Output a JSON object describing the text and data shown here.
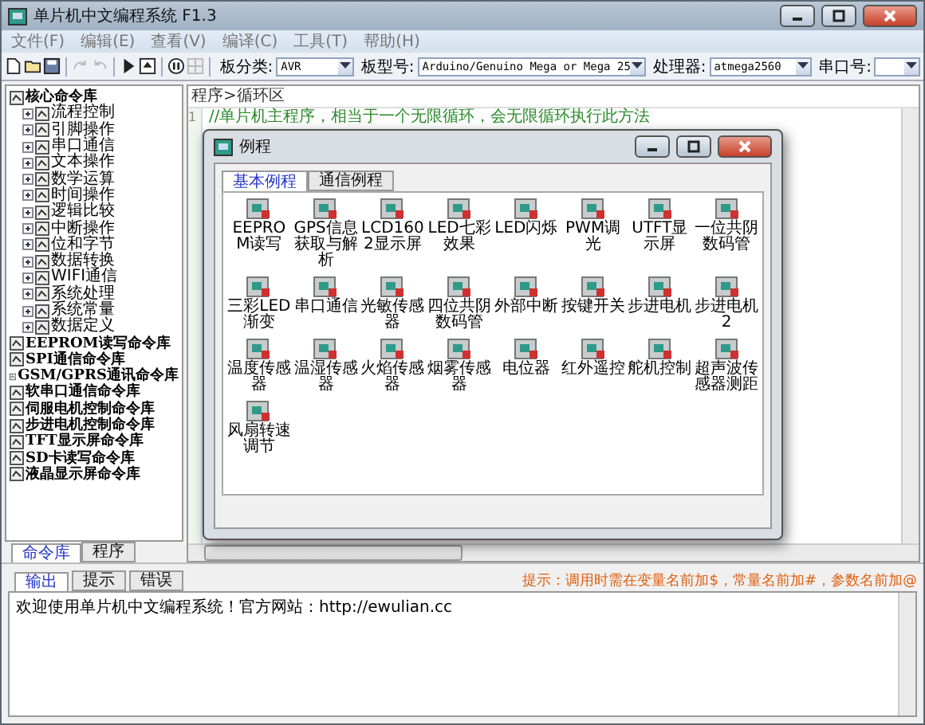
{
  "window": {
    "title": "单片机中文编程系统 F1.3"
  },
  "menu": [
    "文件(F)",
    "编辑(E)",
    "查看(V)",
    "编译(C)",
    "工具(T)",
    "帮助(H)"
  ],
  "toolbar": {
    "groups": [
      [
        {
          "kind": "new",
          "disabled": false
        },
        {
          "kind": "open",
          "disabled": false
        },
        {
          "kind": "save",
          "disabled": false
        }
      ],
      [
        {
          "kind": "redo",
          "disabled": true
        },
        {
          "kind": "undo",
          "disabled": true
        }
      ],
      [
        {
          "kind": "run",
          "disabled": false
        },
        {
          "kind": "upload",
          "disabled": false
        }
      ],
      [
        {
          "kind": "pause",
          "disabled": false
        },
        {
          "kind": "monitor",
          "disabled": true
        }
      ]
    ],
    "selectors": [
      {
        "label": "板分类:",
        "value": "AVR"
      },
      {
        "label": "板型号:",
        "value": "Arduino/Genuino Mega or Mega 25"
      },
      {
        "label": "处理器:",
        "value": "atmega2560"
      },
      {
        "label": "串口号:"
      }
    ]
  },
  "library": {
    "tree": [
      {
        "label": "核心命令库",
        "children": [
          {
            "label": "流程控制",
            "expanded": false
          },
          {
            "label": "引脚操作",
            "expanded": false
          },
          {
            "label": "串口通信",
            "expanded": false
          },
          {
            "label": "文本操作",
            "expanded": false
          },
          {
            "label": "数学运算",
            "expanded": false
          },
          {
            "label": "时间操作",
            "expanded": false
          },
          {
            "label": "逻辑比较",
            "expanded": false
          },
          {
            "label": "中断操作",
            "expanded": false
          },
          {
            "label": "位和字节",
            "expanded": false
          },
          {
            "label": "数据转换",
            "expanded": false
          },
          {
            "label": "WIFI通信",
            "expanded": false
          },
          {
            "label": "系统处理",
            "expanded": false
          },
          {
            "label": "系统常量",
            "expanded": false
          },
          {
            "label": "数据定义",
            "expanded": false
          }
        ]
      },
      {
        "label": "EEPROM读写命令库"
      },
      {
        "label": "SPI通信命令库"
      },
      {
        "label": "GSM/GPRS通讯命令库"
      },
      {
        "label": "软串口通信命令库"
      },
      {
        "label": "伺服电机控制命令库"
      },
      {
        "label": "步进电机控制命令库"
      },
      {
        "label": "TFT显示屏命令库"
      },
      {
        "label": "SD卡读写命令库"
      },
      {
        "label": "液晶显示屏命令库"
      }
    ],
    "tabs": [
      {
        "label": "命令库",
        "selected": true
      },
      {
        "label": "程序",
        "selected": false
      }
    ]
  },
  "editor": {
    "breadcrumb": "程序>循环区",
    "lines": [
      {
        "number": "1",
        "text": "//单片机主程序，相当于一个无限循环，会无限循环执行此方法"
      }
    ]
  },
  "dialog": {
    "title": "例程",
    "tabs": [
      {
        "label": "基本例程",
        "selected": true
      },
      {
        "label": "通信例程",
        "selected": false
      }
    ],
    "examples": [
      "EEPROM读写",
      "GPS信息获取与解析",
      "LCD1602显示屏",
      "LED七彩效果",
      "LED闪烁",
      "PWM调光",
      "UTFT显示屏",
      "一位共阴数码管",
      "三彩LED渐变",
      "串口通信",
      "光敏传感器",
      "四位共阴数码管",
      "外部中断",
      "按键开关",
      "步进电机",
      "步进电机2",
      "温度传感器",
      "温湿传感器",
      "火焰传感器",
      "烟雾传感器",
      "电位器",
      "红外遥控",
      "舵机控制",
      "超声波传感器测距",
      "风扇转速调节"
    ]
  },
  "output": {
    "tabs": [
      {
        "label": "输出",
        "selected": true
      },
      {
        "label": "提示",
        "selected": false
      },
      {
        "label": "错误",
        "selected": false
      }
    ],
    "hint": "提示：调用时需在变量名前加$，常量名前加#，参数名前加@",
    "text": "欢迎使用单片机中文编程系统！官方网站：http://ewulian.cc"
  }
}
